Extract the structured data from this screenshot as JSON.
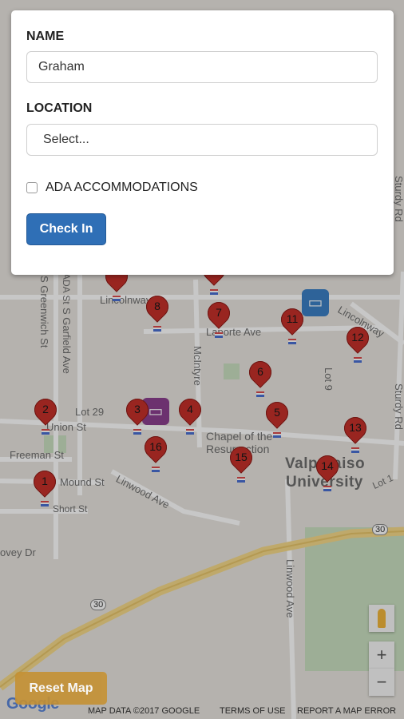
{
  "form": {
    "name_label": "NAME",
    "name_value": "Graham",
    "location_label": "LOCATION",
    "location_value": "Select...",
    "ada_label": "ADA ACCOMMODATIONS",
    "ada_checked": false,
    "checkin_label": "Check In"
  },
  "map": {
    "streets": {
      "linwood_ave": "Linwood Ave",
      "linwood_ave_v": "Linwood Ave",
      "mound_st": "Mound St",
      "short_st": "Short St",
      "freeman_st": "Freeman St",
      "union_st": "Union St",
      "laporte_ave": "Laporte Ave",
      "lincolnway": "Lincolnway",
      "lincolnway_east": "Lincolnway",
      "s_greenwich_st": "S Greenwich St",
      "s_garfield_ave": "S Garfield Ave",
      "ada_st": "ADA St",
      "mcintyre": "McIntyre",
      "lot_29": "Lot 29",
      "lot_9": "Lot 9",
      "lot_1": "Lot 1",
      "covey_dr": "ovey Dr",
      "sturdy_rd_top": "Sturdy Rd",
      "sturdy_rd_bottom": "Sturdy Rd",
      "highway_30_a": "30",
      "highway_30_b": "30"
    },
    "poi_chapel": "Chapel of the Resurrection",
    "university_line1": "Valparaiso",
    "university_line2": "University",
    "markers": [
      "1",
      "2",
      "3",
      "4",
      "5",
      "6",
      "7",
      "8",
      "11",
      "12",
      "13",
      "14",
      "15",
      "16"
    ],
    "reset_label": "Reset Map",
    "zoom_in": "+",
    "zoom_out": "−",
    "google_logo": "Google",
    "attribution": {
      "map_data": "MAP DATA ©2017 GOOGLE",
      "terms": "TERMS OF USE",
      "report": "REPORT A MAP ERROR"
    }
  },
  "colors": {
    "marker": "#c5302a",
    "bus_blue": "#3b7fc4",
    "bus_purple": "#8b3f8f",
    "button": "#2f6fb6",
    "reset": "#c59134"
  }
}
